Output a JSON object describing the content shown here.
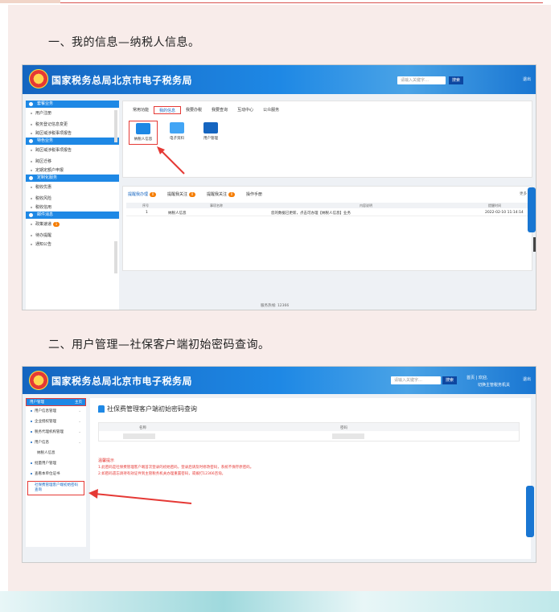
{
  "section1": {
    "title": "一、我的信息—纳税人信息。",
    "app": {
      "title": "国家税务总局北京市电子税务局",
      "search_placeholder": "请输入关键字…",
      "search_button": "搜索",
      "header_right": "退出"
    },
    "sidebar": {
      "groups": [
        {
          "label": "套餐业务",
          "items": [
            "用户注册",
            "税务登记信息变更",
            "跨区域涉税事项报告"
          ]
        },
        {
          "label": "特色业务",
          "items": [
            "跨区域涉税事项报告",
            "跨区迁移",
            "定期定额户申报"
          ]
        },
        {
          "label": "定制化服务",
          "items": [
            "税收优惠",
            "税收风险",
            "税收信用"
          ]
        },
        {
          "label": "邮件消息",
          "items": [
            "政策速递",
            "待办提醒",
            "通知公告"
          ]
        }
      ],
      "badge": "1"
    },
    "tabs": [
      "常用功能",
      "我的信息",
      "我要办税",
      "我要查询",
      "互动中心",
      "公众服务"
    ],
    "active_tab": "我的信息",
    "tiles": [
      "纳税人信息",
      "电子资料",
      "用户管理"
    ],
    "table": {
      "tabs": [
        {
          "label": "提醒我办理",
          "count": "0"
        },
        {
          "label": "提醒我关注",
          "count": "0"
        },
        {
          "label": "提醒我关注",
          "count": "0"
        },
        {
          "label": "操作手册",
          "count": ""
        }
      ],
      "more": "更多",
      "headers": [
        "序号",
        "事项名称",
        "内容说明",
        "提醒时间"
      ],
      "rows": [
        {
          "no": "1",
          "name": "纳税人信息",
          "desc": "您的数据已更新，点击可办理【纳税人信息】业务",
          "time": "2022-02-10 11:14:14"
        }
      ]
    },
    "footer": "服务热线: 12366"
  },
  "section2": {
    "title": "二、用户管理—社保客户端初始密码查询。",
    "app": {
      "title": "国家税务总局北京市电子税务局",
      "search_placeholder": "请输入关键字…",
      "search_button": "搜索",
      "header_user": "首页 | 欢迎,",
      "header_sub": "切换主管税务机关",
      "header_right": "退出"
    },
    "sidebar": {
      "head": "用户管理",
      "head_right": "主页",
      "items": [
        "用户信息管理",
        "企业授权管理",
        "税务代理机构管理",
        "用户信息",
        "纳税人信息",
        "批量用户管理",
        "查看本单位证书"
      ],
      "selected": "社保费管理客户端初始密码查询"
    },
    "main": {
      "title": "社保费管理客户端初始密码查询",
      "table_headers": [
        "名称",
        "密码"
      ],
      "notes_title": "温馨提示",
      "notes": [
        "1.此密码是社保费管理客户端首次登录的初始密码，登录后请及时修改密码，系统不保存原密码。",
        "2.如密码遗忘请持有效证件到主管税务机关办理重置密码，或拨打12366咨询。"
      ]
    }
  }
}
